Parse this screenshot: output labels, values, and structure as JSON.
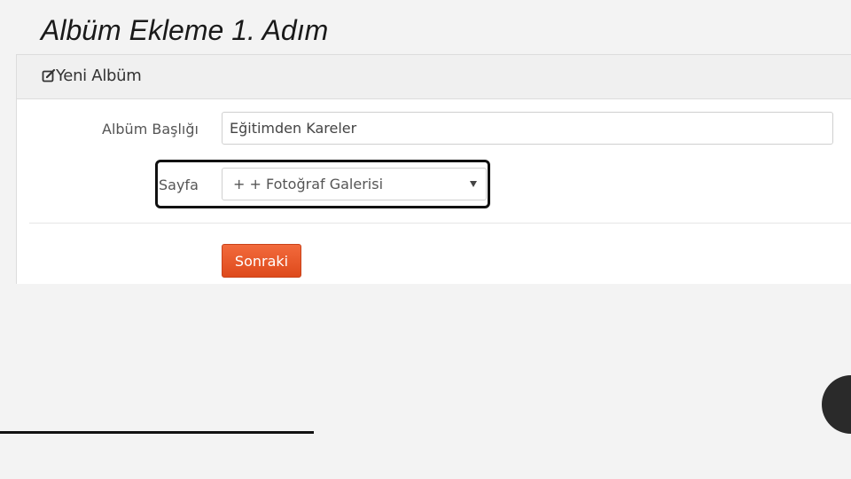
{
  "slide": {
    "title": "Albüm Ekleme 1. Adım"
  },
  "panel": {
    "header_title": "Yeni Albüm",
    "header_icon": "edit-icon"
  },
  "form": {
    "title_label": "Albüm Başlığı",
    "title_value": "Eğitimden Kareler",
    "page_label": "Sayfa",
    "page_selected": "+ + Fotoğraf Galerisi",
    "submit_label": "Sonraki"
  },
  "colors": {
    "accent_button": "#e8562a",
    "highlight_border": "#111111",
    "slide_background": "#f3f3f3"
  }
}
